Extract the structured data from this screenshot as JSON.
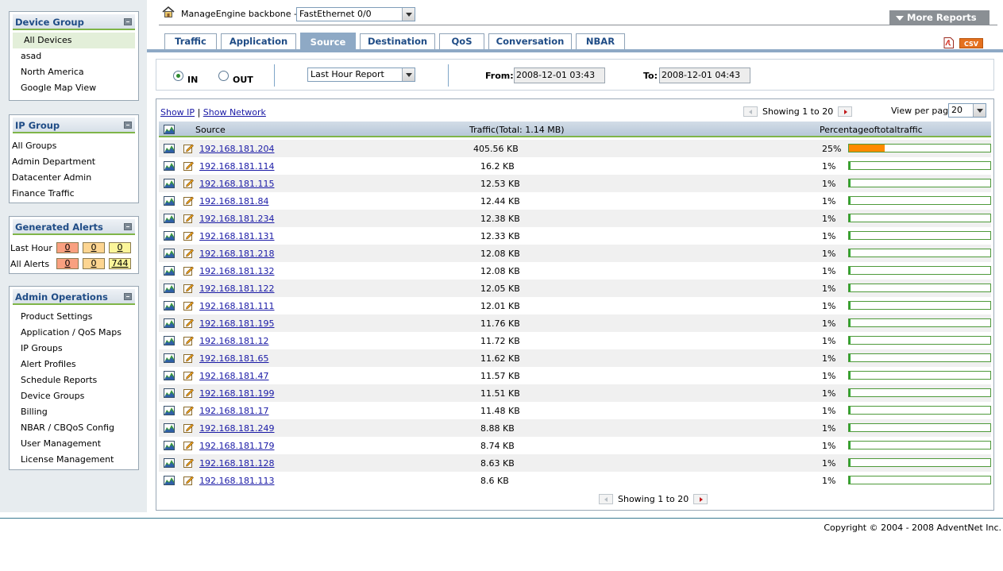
{
  "sidebar": {
    "device_group": {
      "title": "Device Group",
      "items": [
        "All Devices",
        "asad",
        "North America",
        "Google Map View"
      ],
      "selected_index": 0
    },
    "ip_group": {
      "title": "IP Group",
      "items": [
        "All Groups",
        "Admin Department",
        "Datacenter Admin",
        "Finance Traffic"
      ]
    },
    "alerts": {
      "title": "Generated Alerts",
      "rows": [
        {
          "label": "Last Hour",
          "values": [
            "0",
            "0",
            "0"
          ]
        },
        {
          "label": "All Alerts",
          "values": [
            "0",
            "0",
            "744"
          ]
        }
      ],
      "colors": {
        "critical": "#f9a080",
        "major": "#fdd591",
        "minor": "#fbf59a"
      }
    },
    "admin": {
      "title": "Admin Operations",
      "items": [
        "Product Settings",
        "Application / QoS Maps",
        "IP Groups",
        "Alert Profiles",
        "Schedule Reports",
        "Device Groups",
        "Billing",
        "NBAR / CBQoS Config",
        "User Management",
        "License Management"
      ]
    }
  },
  "header": {
    "home_icon": "home-icon",
    "breadcrumb": "ManageEngine backbone -->",
    "interface_select": "FastEthernet 0/0",
    "more_reports": "More Reports",
    "csv_label": "CSV",
    "pdf_icon": "pdf-icon"
  },
  "tabs": [
    "Traffic",
    "Application",
    "Source",
    "Destination",
    "QoS",
    "Conversation",
    "NBAR"
  ],
  "active_tab": "Source",
  "filters": {
    "direction_in": "IN",
    "direction_out": "OUT",
    "selected_direction": "IN",
    "report_period": "Last Hour Report",
    "from_label": "From:",
    "from_value": "2008-12-01 03:43",
    "to_label": "To:",
    "to_value": "2008-12-01 04:43"
  },
  "table": {
    "show_ip": "Show IP",
    "separator": "|",
    "show_network": "Show Network",
    "showing_text": "Showing 1 to 20",
    "view_per_page_label": "View per page",
    "view_per_page": "20",
    "columns": {
      "source": "Source",
      "traffic": "Traffic(Total: 1.14 MB)",
      "percentage": "Percentageoftotaltraffic"
    },
    "rows": [
      {
        "ip": "192.168.181.204",
        "traffic": "405.56 KB",
        "pct": "25%",
        "fraction": 0.25
      },
      {
        "ip": "192.168.181.114",
        "traffic": "16.2 KB",
        "pct": "1%",
        "fraction": 0.01
      },
      {
        "ip": "192.168.181.115",
        "traffic": "12.53 KB",
        "pct": "1%",
        "fraction": 0.01
      },
      {
        "ip": "192.168.181.84",
        "traffic": "12.44 KB",
        "pct": "1%",
        "fraction": 0.01
      },
      {
        "ip": "192.168.181.234",
        "traffic": "12.38 KB",
        "pct": "1%",
        "fraction": 0.01
      },
      {
        "ip": "192.168.181.131",
        "traffic": "12.33 KB",
        "pct": "1%",
        "fraction": 0.01
      },
      {
        "ip": "192.168.181.218",
        "traffic": "12.08 KB",
        "pct": "1%",
        "fraction": 0.01
      },
      {
        "ip": "192.168.181.132",
        "traffic": "12.08 KB",
        "pct": "1%",
        "fraction": 0.01
      },
      {
        "ip": "192.168.181.122",
        "traffic": "12.05 KB",
        "pct": "1%",
        "fraction": 0.01
      },
      {
        "ip": "192.168.181.111",
        "traffic": "12.01 KB",
        "pct": "1%",
        "fraction": 0.01
      },
      {
        "ip": "192.168.181.195",
        "traffic": "11.76 KB",
        "pct": "1%",
        "fraction": 0.01
      },
      {
        "ip": "192.168.181.12",
        "traffic": "11.72 KB",
        "pct": "1%",
        "fraction": 0.01
      },
      {
        "ip": "192.168.181.65",
        "traffic": "11.62 KB",
        "pct": "1%",
        "fraction": 0.01
      },
      {
        "ip": "192.168.181.47",
        "traffic": "11.57 KB",
        "pct": "1%",
        "fraction": 0.01
      },
      {
        "ip": "192.168.181.199",
        "traffic": "11.51 KB",
        "pct": "1%",
        "fraction": 0.01
      },
      {
        "ip": "192.168.181.17",
        "traffic": "11.48 KB",
        "pct": "1%",
        "fraction": 0.01
      },
      {
        "ip": "192.168.181.249",
        "traffic": "8.88 KB",
        "pct": "1%",
        "fraction": 0.01
      },
      {
        "ip": "192.168.181.179",
        "traffic": "8.74 KB",
        "pct": "1%",
        "fraction": 0.01
      },
      {
        "ip": "192.168.181.128",
        "traffic": "8.63 KB",
        "pct": "1%",
        "fraction": 0.01
      },
      {
        "ip": "192.168.181.113",
        "traffic": "8.6 KB",
        "pct": "1%",
        "fraction": 0.01
      }
    ],
    "bar_colors": {
      "high": "#ff8a00",
      "low": "#2ea62e"
    },
    "row_icons": [
      "graph-icon",
      "edit-icon"
    ]
  },
  "footer": {
    "copyright": "Copyright © 2004 - 2008 AdventNet Inc."
  }
}
